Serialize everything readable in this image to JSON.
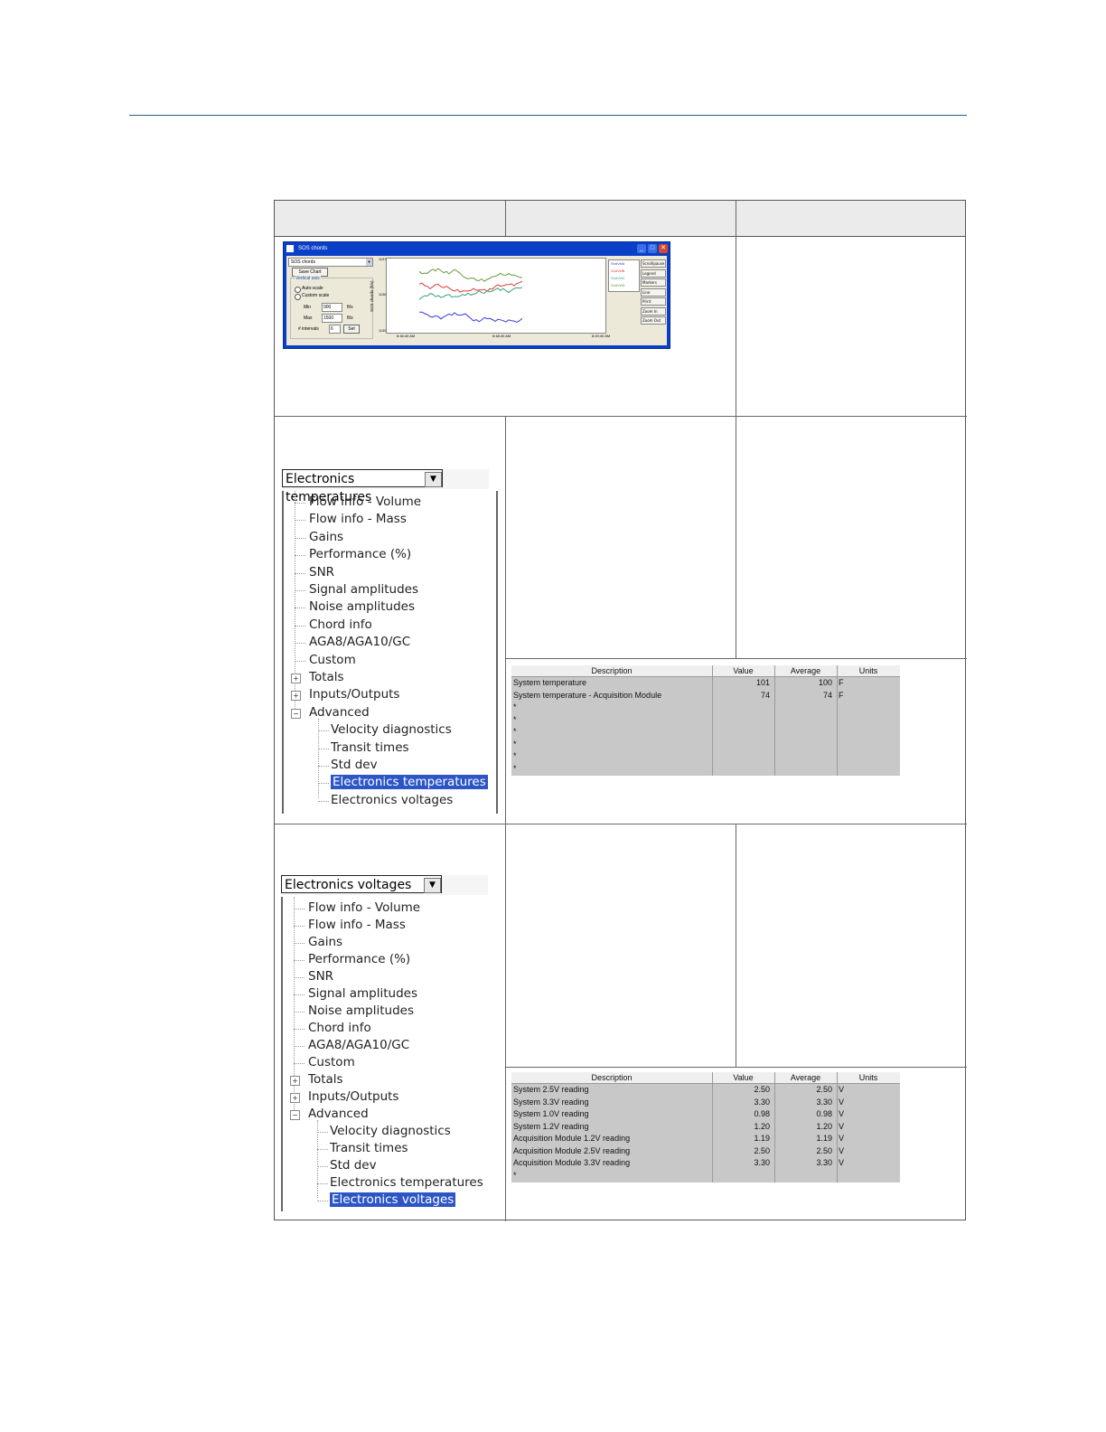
{
  "sos_window": {
    "title": "SOS chords",
    "dropdown": "SOS chords",
    "save_chart": "Save Chart",
    "vertical_axis": "Vertical axis",
    "auto_scale": "Auto-scale",
    "custom_scale": "Custom scale",
    "min_label": "Min",
    "min_value": "900",
    "min_unit": "ft/s",
    "max_label": "Max",
    "max_value": "1500",
    "max_unit": "ft/s",
    "intervals_label": "# intervals",
    "intervals_value": "6",
    "set_button": "Set",
    "y_axis_label": "SOS chords (ft/s)",
    "y_ticks": [
      "1137.00",
      "1136.00",
      "1135.00"
    ],
    "x_ticks": [
      "8:46:40 AM",
      "8:48:40 AM",
      "8:49:40 AM"
    ],
    "legend": [
      "SndVelA",
      "SndVelB",
      "SndVelC",
      "SndVelD"
    ],
    "series_colors": [
      "#3a3ae0",
      "#e03a3a",
      "#3aa07a",
      "#6a9a3a"
    ],
    "side_buttons": [
      "Scroll/pause",
      "Legend",
      "Markers",
      "Line",
      "Print",
      "Zoom In",
      "Zoom Out"
    ]
  },
  "temps_panel": {
    "dropdown": "Electronics temperatures",
    "tree": {
      "items": [
        "Flow info - Volume",
        "Flow info - Mass",
        "Gains",
        "Performance (%)",
        "SNR",
        "Signal amplitudes",
        "Noise amplitudes",
        "Chord info",
        "AGA8/AGA10/GC",
        "Custom"
      ],
      "totals": "Totals",
      "inputs_outputs": "Inputs/Outputs",
      "advanced": "Advanced",
      "advanced_items": [
        "Velocity diagnostics",
        "Transit times",
        "Std dev",
        "Electronics temperatures",
        "Electronics voltages"
      ]
    }
  },
  "temps_grid": {
    "headers": [
      "Description",
      "Value",
      "Average",
      "Units"
    ],
    "rows": [
      [
        "System temperature",
        "101",
        "100",
        "F"
      ],
      [
        "System temperature - Acquisition Module",
        "74",
        "74",
        "F"
      ],
      [
        "*",
        "",
        "",
        ""
      ],
      [
        "*",
        "",
        "",
        ""
      ],
      [
        "*",
        "",
        "",
        ""
      ],
      [
        "*",
        "",
        "",
        ""
      ],
      [
        "*",
        "",
        "",
        ""
      ],
      [
        "*",
        "",
        "",
        ""
      ]
    ]
  },
  "volts_panel": {
    "dropdown": "Electronics voltages",
    "tree": {
      "items": [
        "Flow info - Volume",
        "Flow info - Mass",
        "Gains",
        "Performance (%)",
        "SNR",
        "Signal amplitudes",
        "Noise amplitudes",
        "Chord info",
        "AGA8/AGA10/GC",
        "Custom"
      ],
      "totals": "Totals",
      "inputs_outputs": "Inputs/Outputs",
      "advanced": "Advanced",
      "advanced_items": [
        "Velocity diagnostics",
        "Transit times",
        "Std dev",
        "Electronics temperatures",
        "Electronics voltages"
      ]
    }
  },
  "volts_grid": {
    "headers": [
      "Description",
      "Value",
      "Average",
      "Units"
    ],
    "rows": [
      [
        "System 2.5V reading",
        "2.50",
        "2.50",
        "V"
      ],
      [
        "System 3.3V reading",
        "3.30",
        "3.30",
        "V"
      ],
      [
        "System 1.0V reading",
        "0.98",
        "0.98",
        "V"
      ],
      [
        "System 1.2V reading",
        "1.20",
        "1.20",
        "V"
      ],
      [
        "Acquisition Module 1.2V reading",
        "1.19",
        "1.19",
        "V"
      ],
      [
        "Acquisition Module 2.5V reading",
        "2.50",
        "2.50",
        "V"
      ],
      [
        "Acquisition Module 3.3V reading",
        "3.30",
        "3.30",
        "V"
      ],
      [
        "*",
        "",
        "",
        ""
      ]
    ]
  }
}
